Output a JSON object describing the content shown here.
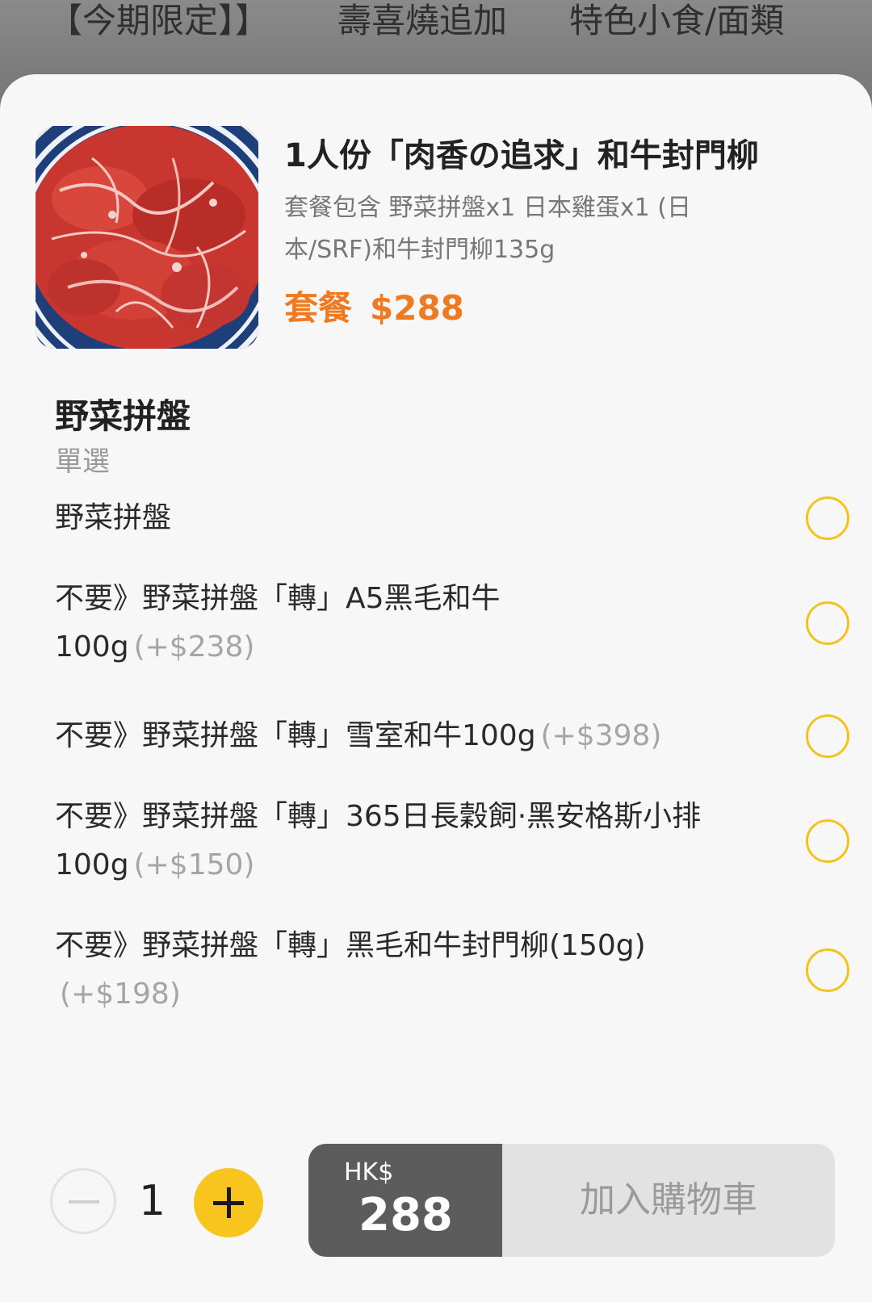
{
  "category_tabs": [
    "【今期限定】】",
    "壽喜燒追加",
    "特色小食/面類"
  ],
  "product": {
    "title": "1人份「肉香の追求」和牛封門柳",
    "description": "套餐包含 野菜拼盤x1 日本雞蛋x1 (日本/SRF)和牛封門柳135g",
    "price_label": "套餐",
    "price": "$288"
  },
  "option_group": {
    "title": "野菜拼盤",
    "subtitle": "單選",
    "options": [
      {
        "label": "野菜拼盤",
        "price": ""
      },
      {
        "label": "不要》野菜拼盤「轉」A5黑毛和牛100g",
        "price": "(+$238)"
      },
      {
        "label": "不要》野菜拼盤「轉」雪室和牛100g",
        "price": "(+$398)"
      },
      {
        "label": "不要》野菜拼盤「轉」365日長穀飼·黑安格斯小排100g",
        "price": "(+$150)"
      },
      {
        "label": "不要》野菜拼盤「轉」黑毛和牛封門柳(150g)",
        "price": "(+$198)"
      }
    ]
  },
  "footer": {
    "quantity": "1",
    "currency": "HK$",
    "total": "288",
    "add_to_cart": "加入購物車"
  },
  "colors": {
    "accent_orange": "#f07a22",
    "radio_yellow": "#f5c21b",
    "plus_yellow": "#f8c51f",
    "total_bg": "#5c5c5c"
  },
  "icons": [
    "minus-icon",
    "plus-icon",
    "radio-icon"
  ]
}
